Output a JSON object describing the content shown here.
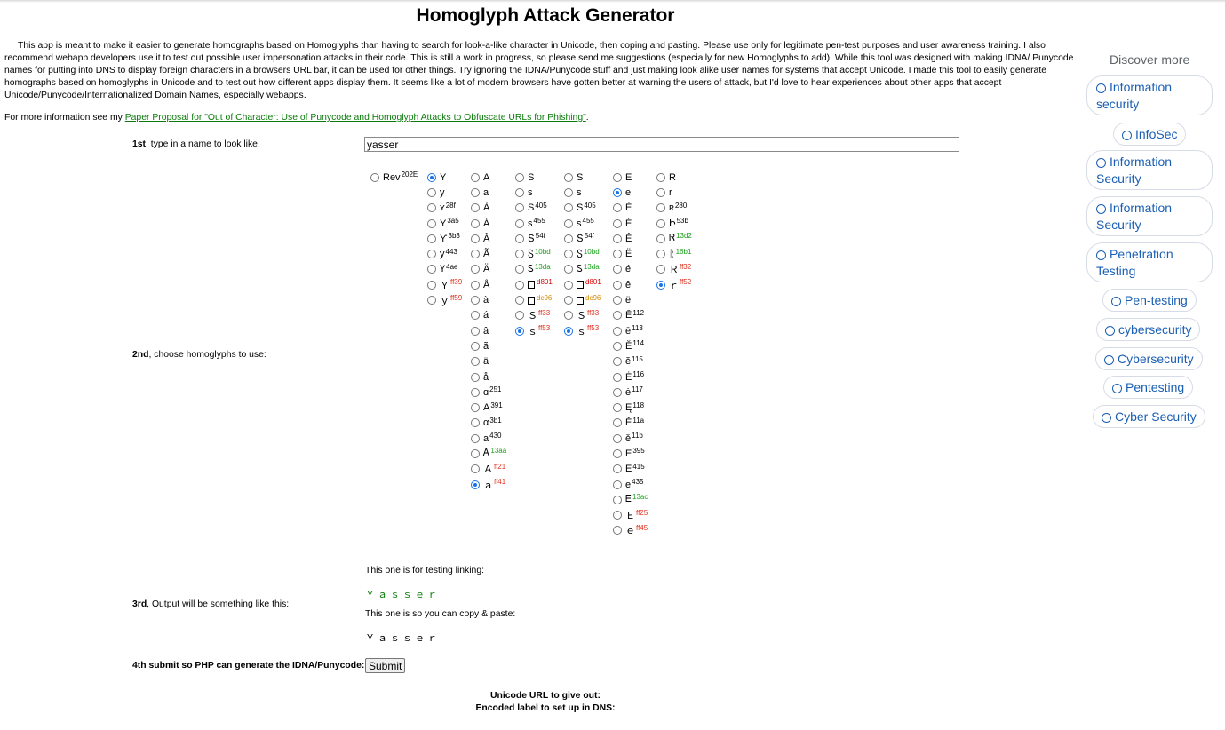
{
  "title": "Homoglyph Attack Generator",
  "intro": "This app is meant to make it easier to generate homographs based on Homoglyphs than having to search for look-a-like character in Unicode, then coping and pasting. Please use only for legitimate pen-test purposes and user awareness training. I also recommend webapp developers use it to test out possible user impersonation attacks in their code. This is still a work in progress, so please send me suggestions (especially for new Homoglyphs to add). While this tool was designed with making IDNA/ Punycode names for putting into DNS to display foreign characters in a browsers URL bar, it can be used for other things. Try ignoring the IDNA/Punycode stuff and just making look alike user names for systems that accept Unicode. I made this tool to easily generate homographs based on homoglyphs in Unicode and to test out how different apps display them. It seems like a lot of modern browsers have gotten better at warning the users of attack, but I'd love to hear experiences about other apps that accept Unicode/Punycode/Internationalized Domain Names, especially webapps.",
  "more_info": {
    "prefix": "For more information see my ",
    "link": "Paper Proposal for \"Out of Character: Use of Punycode and Homoglyph Attacks to Obfuscate URLs for Phishing\"",
    "suffix": "."
  },
  "steps": {
    "step1_bold": "1st",
    "step1_rest": ", type in a name to look like:",
    "step2_bold": "2nd",
    "step2_rest": ", choose homoglyphs to use:",
    "step3_bold": "3rd",
    "step3_rest": ", Output will be something like this:",
    "step4": "4th submit so PHP can generate the IDNA/Punycode:"
  },
  "name_value": "yasser",
  "rev_option": {
    "label": "Rev",
    "sup": "202E"
  },
  "columns": [
    {
      "letter": "Y",
      "options": [
        {
          "ch": "Y",
          "sup": "",
          "c": "black",
          "sel": true
        },
        {
          "ch": "y",
          "sup": "",
          "c": "black"
        },
        {
          "ch": "ʏ",
          "sup": "28f",
          "c": "black"
        },
        {
          "ch": "Υ",
          "sup": "3a5",
          "c": "black"
        },
        {
          "ch": "ϒ",
          "sup": "3b3",
          "c": "black"
        },
        {
          "ch": "у",
          "sup": "443",
          "c": "black"
        },
        {
          "ch": "Ү",
          "sup": "4ae",
          "c": "black"
        },
        {
          "ch": "Ｙ",
          "sup": "ff39",
          "c": "red"
        },
        {
          "ch": "ｙ",
          "sup": "ff59",
          "c": "red"
        }
      ]
    },
    {
      "letter": "A",
      "options": [
        {
          "ch": "A",
          "sup": "",
          "c": "black"
        },
        {
          "ch": "a",
          "sup": "",
          "c": "black"
        },
        {
          "ch": "À",
          "sup": "",
          "c": "black"
        },
        {
          "ch": "Á",
          "sup": "",
          "c": "black"
        },
        {
          "ch": "Â",
          "sup": "",
          "c": "black"
        },
        {
          "ch": "Ã",
          "sup": "",
          "c": "black"
        },
        {
          "ch": "Ä",
          "sup": "",
          "c": "black"
        },
        {
          "ch": "Å",
          "sup": "",
          "c": "black"
        },
        {
          "ch": "à",
          "sup": "",
          "c": "black"
        },
        {
          "ch": "á",
          "sup": "",
          "c": "black"
        },
        {
          "ch": "â",
          "sup": "",
          "c": "black"
        },
        {
          "ch": "ã",
          "sup": "",
          "c": "black"
        },
        {
          "ch": "ä",
          "sup": "",
          "c": "black"
        },
        {
          "ch": "å",
          "sup": "",
          "c": "black"
        },
        {
          "ch": "ɑ",
          "sup": "251",
          "c": "black"
        },
        {
          "ch": "Α",
          "sup": "391",
          "c": "black"
        },
        {
          "ch": "α",
          "sup": "3b1",
          "c": "black"
        },
        {
          "ch": "а",
          "sup": "430",
          "c": "black"
        },
        {
          "ch": "Ꭺ",
          "sup": "13aa",
          "c": "green"
        },
        {
          "ch": "Ａ",
          "sup": "ff21",
          "c": "red"
        },
        {
          "ch": "ａ",
          "sup": "ff41",
          "c": "red",
          "sel": true
        }
      ]
    },
    {
      "letter": "S",
      "options": [
        {
          "ch": "S",
          "sup": "",
          "c": "black"
        },
        {
          "ch": "s",
          "sup": "",
          "c": "black"
        },
        {
          "ch": "Ѕ",
          "sup": "405",
          "c": "black"
        },
        {
          "ch": "ѕ",
          "sup": "455",
          "c": "black"
        },
        {
          "ch": "Տ",
          "sup": "54f",
          "c": "black"
        },
        {
          "ch": "Ⴝ",
          "sup": "10bd",
          "c": "green"
        },
        {
          "ch": "Ꮪ",
          "sup": "13da",
          "c": "green"
        },
        {
          "ch": "",
          "sup": "d801",
          "c": "dark",
          "box": true
        },
        {
          "ch": "",
          "sup": "dc96",
          "c": "orange",
          "box": true
        },
        {
          "ch": "Ｓ",
          "sup": "ff33",
          "c": "red"
        },
        {
          "ch": "ｓ",
          "sup": "ff53",
          "c": "red",
          "sel": true
        }
      ]
    },
    {
      "letter": "S",
      "options": [
        {
          "ch": "S",
          "sup": "",
          "c": "black"
        },
        {
          "ch": "s",
          "sup": "",
          "c": "black"
        },
        {
          "ch": "Ѕ",
          "sup": "405",
          "c": "black"
        },
        {
          "ch": "ѕ",
          "sup": "455",
          "c": "black"
        },
        {
          "ch": "Տ",
          "sup": "54f",
          "c": "black"
        },
        {
          "ch": "Ⴝ",
          "sup": "10bd",
          "c": "green"
        },
        {
          "ch": "Ꮪ",
          "sup": "13da",
          "c": "green"
        },
        {
          "ch": "",
          "sup": "d801",
          "c": "dark",
          "box": true
        },
        {
          "ch": "",
          "sup": "dc96",
          "c": "orange",
          "box": true
        },
        {
          "ch": "Ｓ",
          "sup": "ff33",
          "c": "red"
        },
        {
          "ch": "ｓ",
          "sup": "ff53",
          "c": "red",
          "sel": true
        }
      ]
    },
    {
      "letter": "E",
      "options": [
        {
          "ch": "E",
          "sup": "",
          "c": "black"
        },
        {
          "ch": "e",
          "sup": "",
          "c": "black",
          "sel": true
        },
        {
          "ch": "È",
          "sup": "",
          "c": "black"
        },
        {
          "ch": "É",
          "sup": "",
          "c": "black"
        },
        {
          "ch": "Ê",
          "sup": "",
          "c": "black"
        },
        {
          "ch": "Ë",
          "sup": "",
          "c": "black"
        },
        {
          "ch": "é",
          "sup": "",
          "c": "black"
        },
        {
          "ch": "ê",
          "sup": "",
          "c": "black"
        },
        {
          "ch": "ë",
          "sup": "",
          "c": "black"
        },
        {
          "ch": "Ē",
          "sup": "112",
          "c": "black"
        },
        {
          "ch": "ē",
          "sup": "113",
          "c": "black"
        },
        {
          "ch": "Ĕ",
          "sup": "114",
          "c": "black"
        },
        {
          "ch": "ĕ",
          "sup": "115",
          "c": "black"
        },
        {
          "ch": "Ė",
          "sup": "116",
          "c": "black"
        },
        {
          "ch": "ė",
          "sup": "117",
          "c": "black"
        },
        {
          "ch": "Ę",
          "sup": "118",
          "c": "black"
        },
        {
          "ch": "Ě",
          "sup": "11a",
          "c": "black"
        },
        {
          "ch": "ě",
          "sup": "11b",
          "c": "black"
        },
        {
          "ch": "Ε",
          "sup": "395",
          "c": "black"
        },
        {
          "ch": "Е",
          "sup": "415",
          "c": "black"
        },
        {
          "ch": "е",
          "sup": "435",
          "c": "black"
        },
        {
          "ch": "Ꭼ",
          "sup": "13ac",
          "c": "green"
        },
        {
          "ch": "Ｅ",
          "sup": "ff25",
          "c": "red"
        },
        {
          "ch": "ｅ",
          "sup": "ff45",
          "c": "red"
        }
      ]
    },
    {
      "letter": "R",
      "options": [
        {
          "ch": "R",
          "sup": "",
          "c": "black"
        },
        {
          "ch": "r",
          "sup": "",
          "c": "black"
        },
        {
          "ch": "ʀ",
          "sup": "280",
          "c": "black"
        },
        {
          "ch": "Ի",
          "sup": "53b",
          "c": "black"
        },
        {
          "ch": "Ꮢ",
          "sup": "13d2",
          "c": "green"
        },
        {
          "ch": "ᚱ",
          "sup": "16b1",
          "c": "green"
        },
        {
          "ch": "Ｒ",
          "sup": "ff32",
          "c": "red"
        },
        {
          "ch": "ｒ",
          "sup": "ff52",
          "c": "red",
          "sel": true
        }
      ]
    }
  ],
  "output": {
    "link_note": "This one is for testing linking:",
    "link_value": "Ｙａｓｓｅｒ",
    "copy_note": "This one is so you can copy & paste:",
    "copy_value": "Ｙａｓｓｅｒ"
  },
  "submit_label": "Submit",
  "result_labels": {
    "unicode_url": "Unicode URL to give out:",
    "encoded_label": "Encoded label to set up in DNS:"
  },
  "sidebar": {
    "heading": "Discover more",
    "pills": [
      "Information security",
      "InfoSec",
      "Information Security",
      "Information Security",
      "Penetration Testing",
      "Pen-testing",
      "cybersecurity",
      "Cybersecurity",
      "Pentesting",
      "Cyber Security"
    ]
  }
}
